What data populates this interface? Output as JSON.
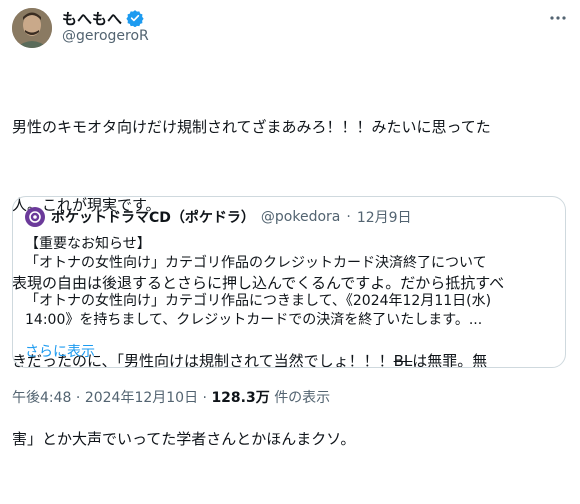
{
  "tweet": {
    "display_name": "もへもへ",
    "handle": "@gerogeroR",
    "verified_icon": "verified-badge-icon",
    "more_icon": "more-horizontal-icon",
    "lines": [
      "男性のキモオタ向けだけ規制されてざまあみろ！！！みたいに思ってた",
      "人。これが現実です。",
      "表現の自由は後退するとさらに押し込んでくるんですよ。だから抵抗すべ",
      "きだったのに、「男性向けは規制されて当然でしょ！！！"
    ],
    "strike_text": "BL",
    "line4_tail": "は無罪。無",
    "line5": "害」とか大声でいってた学者さんとかほんまクソ。"
  },
  "quote": {
    "name": "ポケットドラマCD（ポケドラ）",
    "handle": "@pokedora",
    "separator": "·",
    "date": "12月9日",
    "lines": [
      "【重要なお知らせ】",
      "「オトナの女性向け」カテゴリ作品のクレジットカード決済終了について",
      "",
      "「オトナの女性向け」カテゴリ作品につきまして、《2024年12月11日(水)",
      "14:00》を持ちまして、クレジットカードでの決済を終了いたします。..."
    ],
    "show_more": "さらに表示"
  },
  "footer": {
    "time": "午後4:48",
    "separator": "·",
    "date": "2024年12月10日",
    "views_count": "128.3万",
    "views_label": "件の表示"
  },
  "colors": {
    "text": "#0f1419",
    "secondary": "#536471",
    "link": "#1d9bf0",
    "border": "#cfd9de"
  }
}
